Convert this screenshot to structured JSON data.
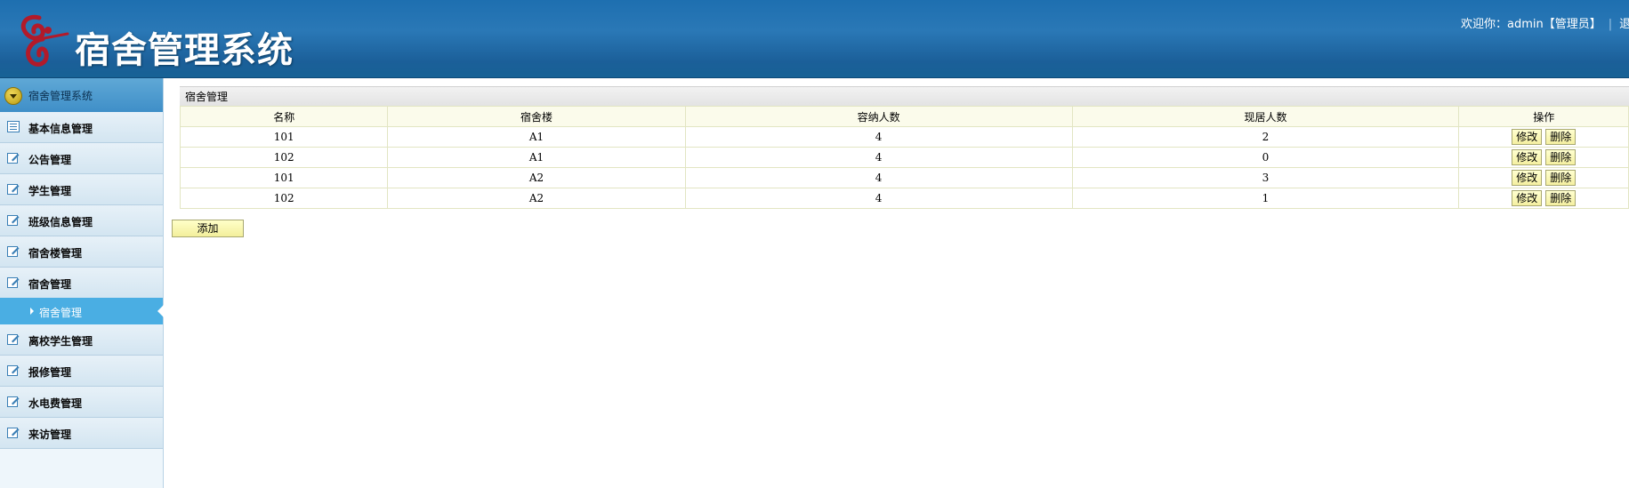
{
  "header": {
    "title": "宿舍管理系统",
    "welcome": "欢迎你：admin【管理员】",
    "logout": "退"
  },
  "sidebar": {
    "head": "宿舍管理系统",
    "items": [
      {
        "label": "基本信息管理",
        "icon": "list-icon"
      },
      {
        "label": "公告管理",
        "icon": "edit-icon"
      },
      {
        "label": "学生管理",
        "icon": "edit-icon"
      },
      {
        "label": "班级信息管理",
        "icon": "edit-icon"
      },
      {
        "label": "宿舍楼管理",
        "icon": "edit-icon"
      },
      {
        "label": "宿舍管理",
        "icon": "edit-icon"
      },
      {
        "label": "离校学生管理",
        "icon": "edit-icon"
      },
      {
        "label": "报修管理",
        "icon": "edit-icon"
      },
      {
        "label": "水电费管理",
        "icon": "edit-icon"
      },
      {
        "label": "来访管理",
        "icon": "edit-icon"
      }
    ],
    "active_sub": "宿舍管理"
  },
  "main": {
    "panel_title": "宿舍管理",
    "columns": [
      "名称",
      "宿舍楼",
      "容纳人数",
      "现居人数",
      "操作"
    ],
    "rows": [
      {
        "name": "101",
        "building": "A1",
        "capacity": "4",
        "current": "2"
      },
      {
        "name": "102",
        "building": "A1",
        "capacity": "4",
        "current": "0"
      },
      {
        "name": "101",
        "building": "A2",
        "capacity": "4",
        "current": "3"
      },
      {
        "name": "102",
        "building": "A2",
        "capacity": "4",
        "current": "1"
      }
    ],
    "edit_label": "修改",
    "delete_label": "删除",
    "add_label": "添加"
  }
}
